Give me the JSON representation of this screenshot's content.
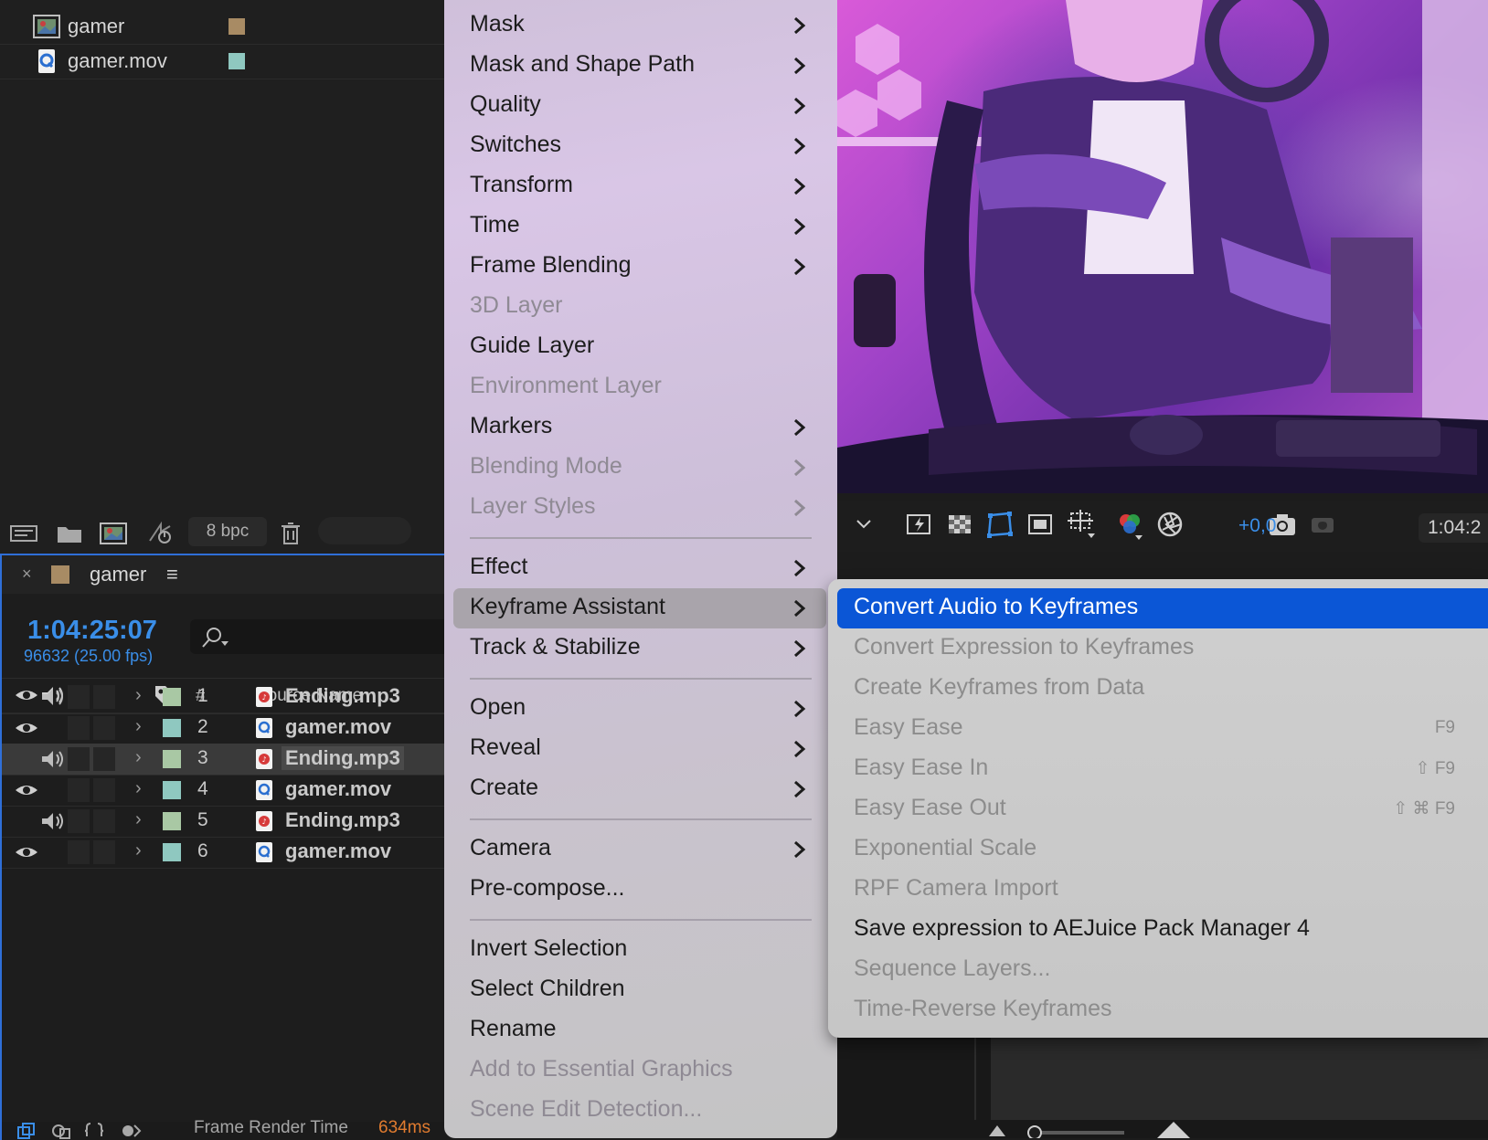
{
  "project": {
    "items": [
      {
        "name": "gamer",
        "icon": "composition-icon",
        "label_color": "#a88b64"
      },
      {
        "name": "gamer.mov",
        "icon": "quicktime-file-icon",
        "label_color": "#8fc8c0"
      }
    ],
    "bpc": "8 bpc"
  },
  "timeline": {
    "comp_name": "gamer",
    "close": "×",
    "menu": "≡",
    "timecode": "1:04:25:07",
    "frames": "96632 (25.00 fps)",
    "col_num": "#",
    "col_source": "Source Name",
    "layers": [
      {
        "num": "1",
        "name": "Ending.mp3",
        "type": "audio",
        "label_color": "#a9c8a4",
        "selected": false
      },
      {
        "num": "2",
        "name": "gamer.mov",
        "type": "video",
        "label_color": "#8fc8c0",
        "selected": false
      },
      {
        "num": "3",
        "name": "Ending.mp3",
        "type": "audio",
        "label_color": "#a9c8a4",
        "selected": true
      },
      {
        "num": "4",
        "name": "gamer.mov",
        "type": "video",
        "label_color": "#8fc8c0",
        "selected": false
      },
      {
        "num": "5",
        "name": "Ending.mp3",
        "type": "audio",
        "label_color": "#a9c8a4",
        "selected": false
      },
      {
        "num": "6",
        "name": "gamer.mov",
        "type": "video",
        "label_color": "#8fc8c0",
        "selected": false
      }
    ],
    "frame_render_label": "Frame Render Time",
    "frame_render_value": "634ms"
  },
  "viewer": {
    "exposure": "+0,0",
    "timecode": "1:04:2"
  },
  "context_menu": {
    "items": [
      {
        "label": "Mask",
        "submenu": true,
        "enabled": true
      },
      {
        "label": "Mask and Shape Path",
        "submenu": true,
        "enabled": true
      },
      {
        "label": "Quality",
        "submenu": true,
        "enabled": true
      },
      {
        "label": "Switches",
        "submenu": true,
        "enabled": true
      },
      {
        "label": "Transform",
        "submenu": true,
        "enabled": true
      },
      {
        "label": "Time",
        "submenu": true,
        "enabled": true
      },
      {
        "label": "Frame Blending",
        "submenu": true,
        "enabled": true
      },
      {
        "label": "3D Layer",
        "submenu": false,
        "enabled": false
      },
      {
        "label": "Guide Layer",
        "submenu": false,
        "enabled": true
      },
      {
        "label": "Environment Layer",
        "submenu": false,
        "enabled": false
      },
      {
        "label": "Markers",
        "submenu": true,
        "enabled": true
      },
      {
        "label": "Blending Mode",
        "submenu": true,
        "enabled": false
      },
      {
        "label": "Layer Styles",
        "submenu": true,
        "enabled": false
      },
      {
        "separator": true
      },
      {
        "label": "Effect",
        "submenu": true,
        "enabled": true
      },
      {
        "label": "Keyframe Assistant",
        "submenu": true,
        "enabled": true,
        "highlighted": true
      },
      {
        "label": "Track & Stabilize",
        "submenu": true,
        "enabled": true
      },
      {
        "separator": true
      },
      {
        "label": "Open",
        "submenu": true,
        "enabled": true
      },
      {
        "label": "Reveal",
        "submenu": true,
        "enabled": true
      },
      {
        "label": "Create",
        "submenu": true,
        "enabled": true
      },
      {
        "separator": true
      },
      {
        "label": "Camera",
        "submenu": true,
        "enabled": true
      },
      {
        "label": "Pre-compose...",
        "submenu": false,
        "enabled": true
      },
      {
        "separator": true
      },
      {
        "label": "Invert Selection",
        "submenu": false,
        "enabled": true
      },
      {
        "label": "Select Children",
        "submenu": false,
        "enabled": true
      },
      {
        "label": "Rename",
        "submenu": false,
        "enabled": true
      },
      {
        "label": "Add to Essential Graphics",
        "submenu": false,
        "enabled": false
      },
      {
        "label": "Scene Edit Detection...",
        "submenu": false,
        "enabled": false
      }
    ]
  },
  "keyframe_submenu": {
    "items": [
      {
        "label": "Convert Audio to Keyframes",
        "enabled": true,
        "active": true,
        "shortcut": ""
      },
      {
        "label": "Convert Expression to Keyframes",
        "enabled": false,
        "shortcut": ""
      },
      {
        "label": "Create Keyframes from Data",
        "enabled": false,
        "shortcut": ""
      },
      {
        "label": "Easy Ease",
        "enabled": false,
        "shortcut": "F9"
      },
      {
        "label": "Easy Ease In",
        "enabled": false,
        "shortcut": "⇧ F9"
      },
      {
        "label": "Easy Ease Out",
        "enabled": false,
        "shortcut": "⇧ ⌘ F9"
      },
      {
        "label": "Exponential Scale",
        "enabled": false,
        "shortcut": ""
      },
      {
        "label": "RPF Camera Import",
        "enabled": false,
        "shortcut": ""
      },
      {
        "label": "Save expression to AEJuice Pack Manager 4",
        "enabled": true,
        "shortcut": ""
      },
      {
        "label": "Sequence Layers...",
        "enabled": false,
        "shortcut": ""
      },
      {
        "label": "Time-Reverse Keyframes",
        "enabled": false,
        "shortcut": ""
      }
    ]
  },
  "colors": {
    "accent_blue": "#0b56d6",
    "timecode_blue": "#3a8ee8",
    "render_orange": "#e07b2f"
  }
}
